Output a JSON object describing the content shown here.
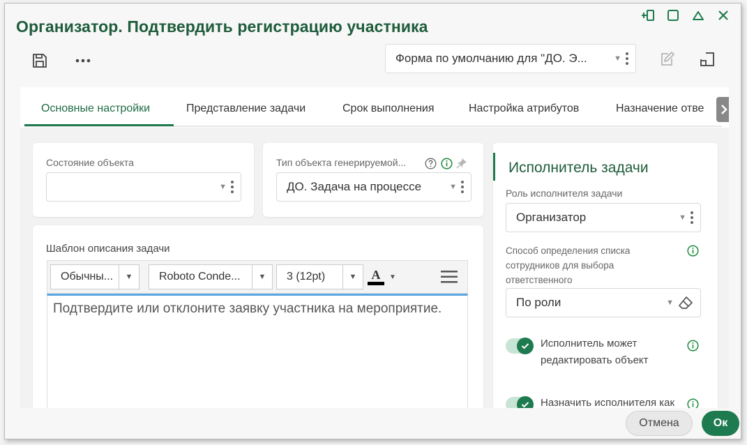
{
  "window": {
    "title": "Организатор. Подтвердить регистрацию участника"
  },
  "toolbar": {
    "form_select_value": "Форма по умолчанию для \"ДО. Э..."
  },
  "tabs": [
    {
      "label": "Основные настройки"
    },
    {
      "label": "Представление задачи"
    },
    {
      "label": "Срок выполнения"
    },
    {
      "label": "Настройка атрибутов"
    },
    {
      "label": "Назначение отве"
    }
  ],
  "left_panel": {
    "state_label": "Состояние объекта",
    "state_value": "",
    "type_label": "Тип объекта генерируемой...",
    "type_value": "ДО. Задача на процессе"
  },
  "editor": {
    "label": "Шаблон описания задачи",
    "style_value": "Обычны...",
    "font_value": "Roboto Conde...",
    "size_value": "3 (12pt)",
    "font_color_glyph": "A",
    "content": "Подтвердите или отклоните заявку участника на мероприятие."
  },
  "assignee": {
    "title": "Исполнитель задачи",
    "role_label": "Роль исполнителя задачи",
    "role_value": "Организатор",
    "method_label": "Способ определения списка сотрудников для выбора ответственного",
    "method_value": "По роли",
    "toggle1_label": "Исполнитель может редактировать объект",
    "toggle2_label": "Назначить исполнителя как"
  },
  "footer": {
    "cancel_label": "Отмена",
    "ok_label": "Ок"
  },
  "colors": {
    "accent": "#1e7a4f",
    "title": "#1e5c3a"
  }
}
